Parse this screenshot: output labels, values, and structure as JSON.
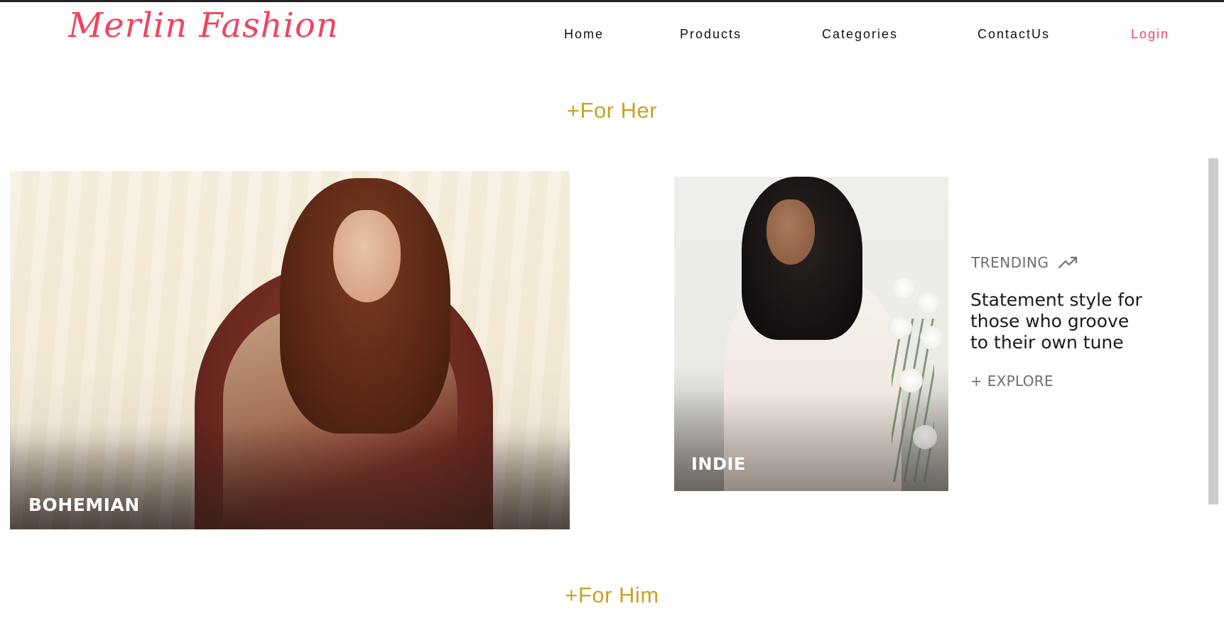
{
  "brand": {
    "logo_text": "Merlin Fashion",
    "accent_color": "#f0455e"
  },
  "nav": {
    "items": [
      {
        "label": "Home"
      },
      {
        "label": "Products"
      },
      {
        "label": "Categories"
      },
      {
        "label": "ContactUs"
      },
      {
        "label": "Login"
      }
    ]
  },
  "sections": {
    "for_her": {
      "title": "+For Her",
      "color": "#c9a227"
    },
    "for_him": {
      "title": "+For Him"
    }
  },
  "cards": {
    "left": {
      "label": "BOHEMIAN"
    },
    "right": {
      "label": "INDIE"
    }
  },
  "promo": {
    "trending_label": "TRENDING",
    "trending_icon": "trending-up-icon",
    "headline_line1": "Statement style for",
    "headline_line2": "those who groove",
    "headline_line3": "to their own tune",
    "explore_label": "+ EXPLORE"
  }
}
